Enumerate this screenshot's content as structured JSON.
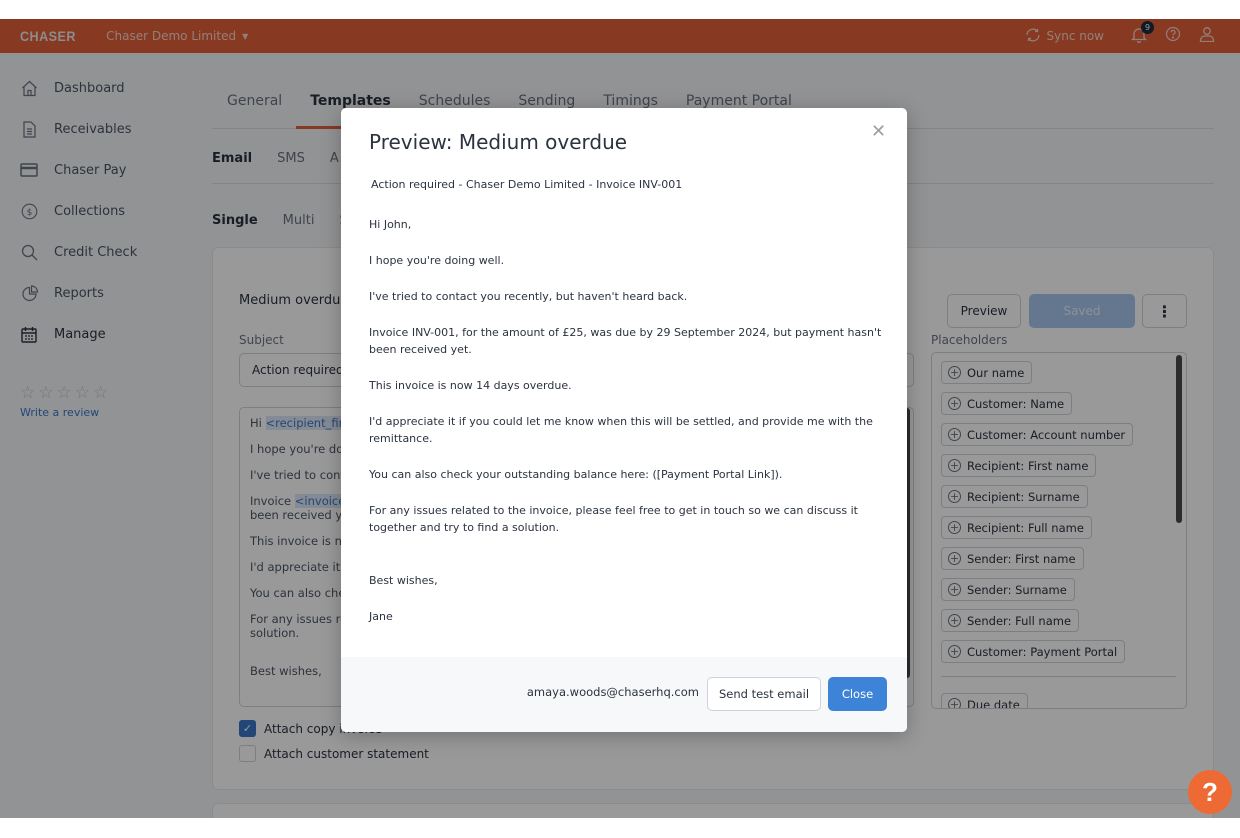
{
  "header": {
    "logo": "CHASER",
    "org_name": "Chaser Demo Limited",
    "sync_label": "Sync now",
    "notification_count": "9",
    "brand_color": "#e2603a"
  },
  "sidebar": {
    "items": [
      {
        "label": "Dashboard",
        "icon": "home-icon"
      },
      {
        "label": "Receivables",
        "icon": "document-icon"
      },
      {
        "label": "Chaser Pay",
        "icon": "card-icon"
      },
      {
        "label": "Collections",
        "icon": "dollar-circle-icon"
      },
      {
        "label": "Credit Check",
        "icon": "search-icon"
      },
      {
        "label": "Reports",
        "icon": "pie-chart-icon"
      },
      {
        "label": "Manage",
        "icon": "calendar-icon",
        "active": true
      }
    ],
    "rating_stars": 5,
    "review_link": "Write a review"
  },
  "main": {
    "tabs": [
      {
        "label": "General"
      },
      {
        "label": "Templates",
        "active": true
      },
      {
        "label": "Schedules"
      },
      {
        "label": "Sending"
      },
      {
        "label": "Timings"
      },
      {
        "label": "Payment Portal"
      }
    ],
    "channel_tabs": [
      {
        "label": "Email",
        "active": true
      },
      {
        "label": "SMS"
      },
      {
        "label": "A"
      }
    ],
    "type_tabs": [
      {
        "label": "Single",
        "active": true
      },
      {
        "label": "Multi"
      },
      {
        "label": "S"
      }
    ],
    "template": {
      "title": "Medium overdue",
      "preview_button": "Preview",
      "saved_button": "Saved",
      "more_button": "⋮",
      "subject_label": "Subject",
      "subject_value": "Action required - ",
      "body_lines": {
        "hi": "Hi ",
        "hi_tag": "<recipient_firs",
        "l2": "I hope you're doir",
        "l3": "I've tried to conta",
        "l4a": "Invoice ",
        "l4_tag": "<invoice_",
        "l4b": "been received yet",
        "l5": "This invoice is no",
        "l6": "I'd appreciate it if",
        "l7": "You can also chec",
        "l8a": "For any issues rel",
        "l8b": "solution.",
        "l9": "Best wishes,"
      },
      "placeholders_label": "Placeholders",
      "placeholders": [
        "Our name",
        "Customer: Name",
        "Customer: Account number",
        "Recipient: First name",
        "Recipient: Surname",
        "Recipient: Full name",
        "Sender: First name",
        "Sender: Surname",
        "Sender: Full name",
        "Customer: Payment Portal"
      ],
      "placeholders_extra": [
        "Due date"
      ],
      "attach_invoice": {
        "label": "Attach copy invoice",
        "checked": true
      },
      "attach_statement": {
        "label": "Attach customer statement",
        "checked": false
      }
    }
  },
  "modal": {
    "title": "Preview: Medium overdue",
    "subject": "Action required - Chaser Demo Limited - Invoice INV-001",
    "greeting": "Hi John,",
    "paragraphs": [
      "I hope you're doing well.",
      "I've tried to contact you recently, but haven't heard back.",
      "Invoice INV-001, for the amount of £25,  was due by 29 September 2024, but  payment hasn't been received yet.",
      "This invoice is now 14 days overdue.",
      "I'd appreciate it if you could let me know when this will be settled, and provide me with the remittance.",
      "You can also check your outstanding balance here: ([Payment Portal Link]).",
      "For any issues related to the invoice, please feel free to get in touch so we can discuss it together and try to find a solution."
    ],
    "signoff": "Best wishes,",
    "signature": "Jane",
    "test_email_address": "amaya.woods@chaserhq.com",
    "send_test_button": "Send test email",
    "close_button": "Close",
    "accent_color": "#3d83d8"
  },
  "help_fab": {
    "label": "?"
  }
}
